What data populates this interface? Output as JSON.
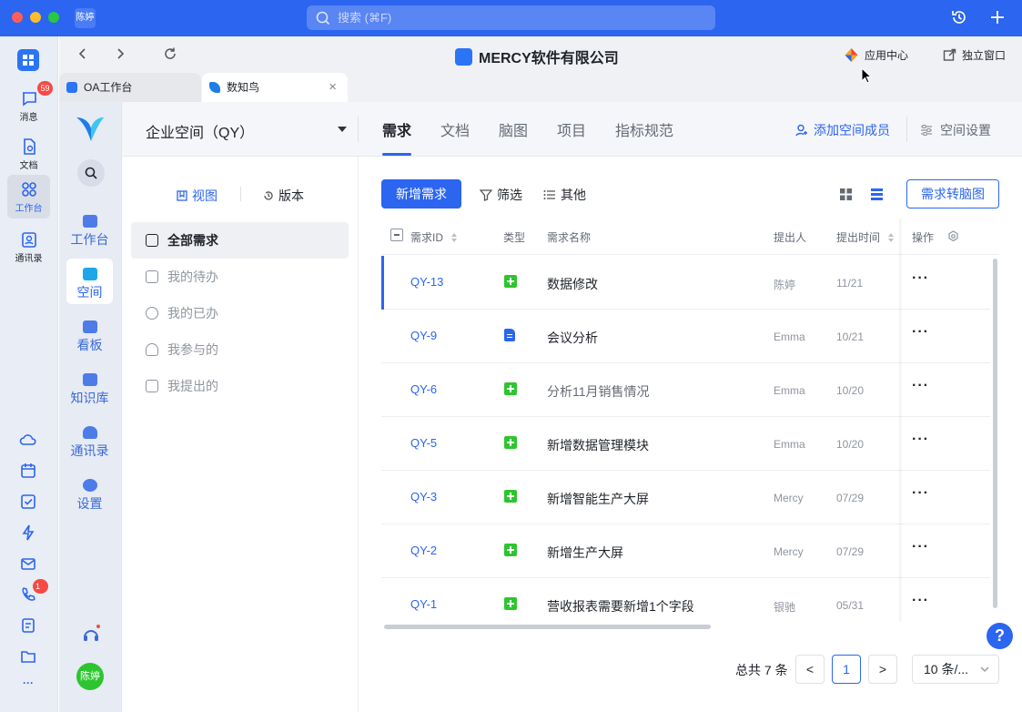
{
  "window": {
    "user_chip": "陈婷",
    "search_placeholder": "搜索 (⌘F)"
  },
  "rail": {
    "items": [
      {
        "label": "消息",
        "badge": "59"
      },
      {
        "label": "文档"
      },
      {
        "label": "工作台"
      },
      {
        "label": "通讯录"
      }
    ],
    "call_badge": "1",
    "more": "···"
  },
  "navbar": {
    "company": "MERCY软件有限公司",
    "app_center": "应用中心",
    "standalone": "独立窗口"
  },
  "tabs": [
    {
      "label": "OA工作台"
    },
    {
      "label": "数知鸟",
      "close": "×"
    }
  ],
  "appside": {
    "items": [
      {
        "label": "工作台"
      },
      {
        "label": "空间"
      },
      {
        "label": "看板"
      },
      {
        "label": "知识库"
      },
      {
        "label": "通讯录"
      },
      {
        "label": "设置"
      }
    ],
    "avatar": "陈婷"
  },
  "header": {
    "space": "企业空间（QY）",
    "tabs": [
      "需求",
      "文档",
      "脑图",
      "项目",
      "指标规范"
    ],
    "add_member": "添加空间成员",
    "space_settings": "空间设置"
  },
  "views": {
    "view_tab": "视图",
    "version_tab": "版本",
    "items": [
      "全部需求",
      "我的待办",
      "我的已办",
      "我参与的",
      "我提出的"
    ]
  },
  "toolbar": {
    "new_button": "新增需求",
    "filter": "筛选",
    "other": "其他",
    "to_mindmap": "需求转脑图"
  },
  "table": {
    "headers": {
      "id": "需求ID",
      "type": "类型",
      "name": "需求名称",
      "author": "提出人",
      "time": "提出时间",
      "ops": "操作"
    },
    "rows": [
      {
        "id": "QY-13",
        "type": "feature",
        "name": "数据修改",
        "author": "陈婷",
        "time": "11/21",
        "ops": "···"
      },
      {
        "id": "QY-9",
        "type": "doc",
        "name": "会议分析",
        "author": "Emma",
        "time": "10/21",
        "ops": "···"
      },
      {
        "id": "QY-6",
        "type": "feature",
        "name": "分析11月销售情况",
        "author": "Emma",
        "time": "10/20",
        "ops": "···"
      },
      {
        "id": "QY-5",
        "type": "feature",
        "name": "新增数据管理模块",
        "author": "Emma",
        "time": "10/20",
        "ops": "···"
      },
      {
        "id": "QY-3",
        "type": "feature",
        "name": "新增智能生产大屏",
        "author": "Mercy",
        "time": "07/29",
        "ops": "···"
      },
      {
        "id": "QY-2",
        "type": "feature",
        "name": "新增生产大屏",
        "author": "Mercy",
        "time": "07/29",
        "ops": "···"
      },
      {
        "id": "QY-1",
        "type": "feature",
        "name": "营收报表需要新增1个字段",
        "author": "银驰",
        "time": "05/31",
        "ops": "···"
      }
    ]
  },
  "pagination": {
    "total": "总共 7 条",
    "page": "1",
    "prev": "<",
    "next": ">",
    "page_size": "10 条/..."
  },
  "help": "?",
  "colors": {
    "accent": "#2b65f0",
    "feature": "#2dc52f",
    "badge": "#f54a45"
  }
}
